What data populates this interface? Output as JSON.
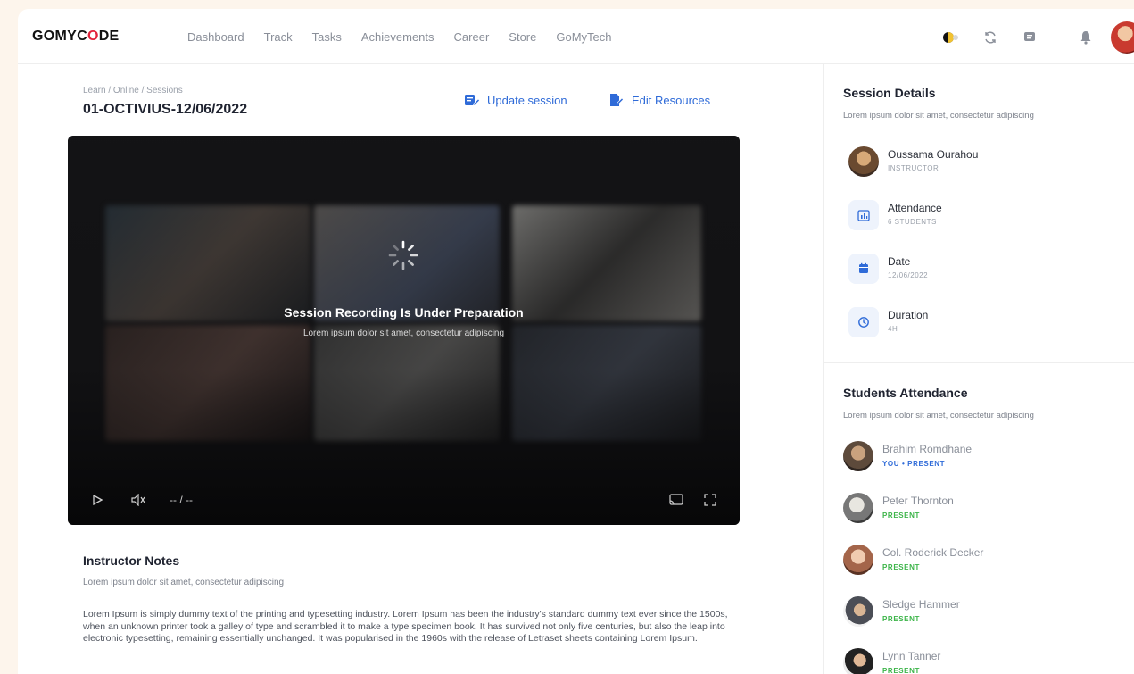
{
  "app": {
    "logo_prefix": "GOMYC",
    "logo_accent": "O",
    "logo_suffix": "DE",
    "nav": [
      "Dashboard",
      "Track",
      "Tasks",
      "Achievements",
      "Career",
      "Store",
      "GoMyTech"
    ]
  },
  "session": {
    "breadcrumb": "Learn / Online / Sessions",
    "title": "01-OCTIVIUS-12/06/2022",
    "update_label": "Update session",
    "edit_label": "Edit Resources"
  },
  "player": {
    "status_title": "Session Recording Is Under Preparation",
    "status_sub": "Lorem ipsum dolor sit amet, consectetur adipiscing",
    "time": "-- / --"
  },
  "notes": {
    "title": "Instructor Notes",
    "subtitle": "Lorem ipsum dolor sit amet, consectetur adipiscing",
    "body": "Lorem Ipsum is simply dummy text of the printing and typesetting industry. Lorem Ipsum has been the industry's standard dummy text ever since the 1500s, when an unknown printer took a galley of type and scrambled it to make a type specimen book. It has survived not only five centuries, but also the leap into electronic typesetting, remaining essentially unchanged. It was popularised in the 1960s with the release of Letraset sheets containing Lorem Ipsum."
  },
  "details": {
    "title": "Session Details",
    "subtitle": "Lorem ipsum dolor sit amet, consectetur adipiscing",
    "instructor_name": "Oussama Ourahou",
    "instructor_role": "INSTRUCTOR",
    "attendance_label": "Attendance",
    "attendance_value": "6 STUDENTS",
    "date_label": "Date",
    "date_value": "12/06/2022",
    "duration_label": "Duration",
    "duration_value": "4H"
  },
  "attendance": {
    "title": "Students Attendance",
    "subtitle": "Lorem ipsum dolor sit amet, consectetur adipiscing",
    "students": [
      {
        "name": "Brahim Romdhane",
        "status": "YOU • PRESENT",
        "color": "#2f6bd8"
      },
      {
        "name": "Peter Thornton",
        "status": "PRESENT",
        "color": "#3db54a"
      },
      {
        "name": "Col. Roderick Decker",
        "status": "PRESENT",
        "color": "#3db54a"
      },
      {
        "name": "Sledge Hammer",
        "status": "PRESENT",
        "color": "#3db54a"
      },
      {
        "name": "Lynn Tanner",
        "status": "PRESENT",
        "color": "#3db54a"
      }
    ]
  },
  "colors": {
    "accent": "#2f6bd8",
    "present": "#3db54a",
    "brand_red": "#e2233b"
  }
}
